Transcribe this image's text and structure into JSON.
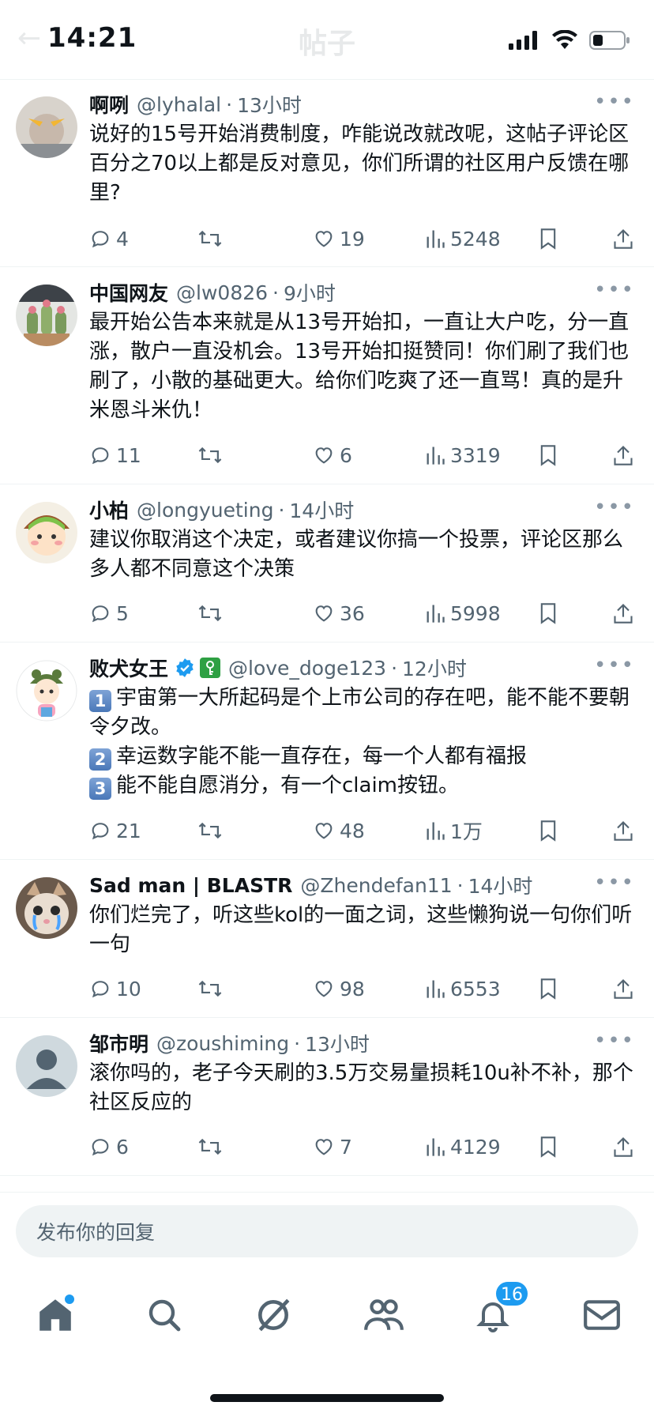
{
  "status_bar": {
    "time": "14:21",
    "ghost_title": "帖子",
    "ghost_back": "←"
  },
  "posts": [
    {
      "name": "啊咧",
      "handle": "@lyhalal",
      "time": "13小时",
      "text": "说好的15号开始消费制度，咋能说改就改呢，这帖子评论区百分之70以上都是反对意见，你们所谓的社区用户反馈在哪里?",
      "replies": "4",
      "likes": "19",
      "views": "5248"
    },
    {
      "name": "中国网友",
      "handle": "@lw0826",
      "time": "9小时",
      "text": "最开始公告本来就是从13号开始扣，一直让大户吃，分一直涨，散户一直没机会。13号开始扣挺赞同！你们刷了我们也刷了，小散的基础更大。给你们吃爽了还一直骂！真的是升米恩斗米仇！",
      "replies": "11",
      "likes": "6",
      "views": "3319"
    },
    {
      "name": "小柏",
      "handle": "@longyueting",
      "time": "14小时",
      "text": "建议你取消这个决定，或者建议你搞一个投票，评论区那么多人都不同意这个决策",
      "replies": "5",
      "likes": "36",
      "views": "5998"
    },
    {
      "name": "败犬女王",
      "handle": "@love_doge123",
      "time": "12小时",
      "list": [
        {
          "num": "1",
          "text": "宇宙第一大所起码是个上市公司的存在吧，能不能不要朝令夕改。"
        },
        {
          "num": "2",
          "text": "幸运数字能不能一直存在，每一个人都有福报"
        },
        {
          "num": "3",
          "text": "能不能自愿消分，有一个claim按钮。"
        }
      ],
      "replies": "21",
      "likes": "48",
      "views": "1万"
    },
    {
      "name": "Sad man | BLASTR",
      "handle": "@Zhendefan11",
      "time": "14小时",
      "text": "你们烂完了，听这些kol的一面之词，这些懒狗说一句你们听一句",
      "replies": "10",
      "likes": "98",
      "views": "6553"
    },
    {
      "name": "邹市明",
      "handle": "@zoushiming",
      "time": "13小时",
      "text": "滚你吗的，老子今天刷的3.5万交易量损耗10u补不补，那个社区反应的",
      "replies": "6",
      "likes": "7",
      "views": "4129"
    }
  ],
  "reply_bar": {
    "placeholder": "发布你的回复"
  },
  "bottom_nav": {
    "notifications_count": "16"
  },
  "colors": {
    "accent": "#1d9bf0",
    "text": "#0f1419",
    "muted": "#536471",
    "divider": "#eff3f4"
  }
}
